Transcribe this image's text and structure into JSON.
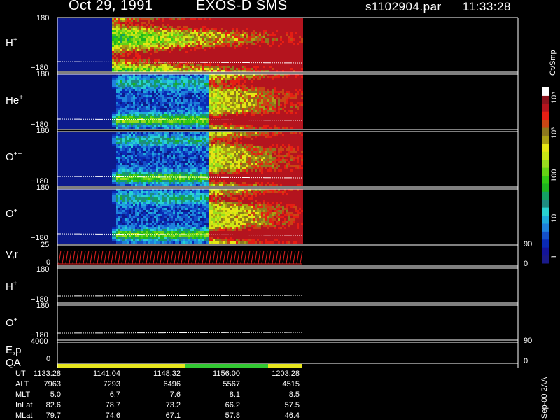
{
  "header": {
    "date": "Oct 29, 1991",
    "instrument": "EXOS-D SMS",
    "file": "s1102904.par",
    "time": "11:33:28"
  },
  "chart_data": {
    "type": "heatmap",
    "panels": [
      {
        "label": "H",
        "sup": "+",
        "ymax": "180",
        "ymin": "−180"
      },
      {
        "label": "He",
        "sup": "+",
        "ymax": "180",
        "ymin": "−180"
      },
      {
        "label": "O",
        "sup": "++",
        "ymax": "180",
        "ymin": "−180"
      },
      {
        "label": "O",
        "sup": "+",
        "ymax": "180",
        "ymin": "−180"
      },
      {
        "label": "V,r",
        "sup": "",
        "ymax": "25",
        "ymin": "0"
      },
      {
        "label": "H",
        "sup": "+",
        "ymax": "180",
        "ymin": "−180"
      },
      {
        "label": "O",
        "sup": "+",
        "ymax": "180",
        "ymin": "−180"
      },
      {
        "label": "E,p",
        "sup": "",
        "ymax": "4000",
        "ymin": ""
      },
      {
        "label": "QA",
        "sup": "",
        "ymax": "",
        "ymin": "0"
      }
    ],
    "right_axis": [
      {
        "top": "90",
        "bottom": "0"
      },
      {
        "top": "90",
        "bottom": "0"
      }
    ],
    "colorbar": {
      "unit": "Ct/Smp",
      "ticks": [
        "1",
        "10",
        "100",
        "10³",
        "10⁴"
      ],
      "colors": [
        "#1a1a8a",
        "#14149a",
        "#0a2ab4",
        "#1450c8",
        "#1e82dc",
        "#1eaadc",
        "#28d2d2",
        "#1e8c82",
        "#14a064",
        "#1eb41e",
        "#32c814",
        "#64d214",
        "#96dc1e",
        "#c8e614",
        "#e6e614",
        "#aaa014",
        "#8c781e",
        "#c84614",
        "#e61e14",
        "#b4141e",
        "#8c141e",
        "#ffffff"
      ]
    },
    "qa_bar": [
      {
        "from": 0,
        "to": 0.52,
        "color": "#e6e61e"
      },
      {
        "from": 0.52,
        "to": 0.86,
        "color": "#32c832"
      },
      {
        "from": 0.86,
        "to": 1.0,
        "color": "#e6e61e"
      }
    ]
  },
  "footer": {
    "rows": [
      {
        "name": "UT",
        "values": [
          "1133:28",
          "1141:04",
          "1148:32",
          "1156:00",
          "1203:28"
        ]
      },
      {
        "name": "ALT",
        "values": [
          "7963",
          "7293",
          "6496",
          "5567",
          "4515"
        ]
      },
      {
        "name": "MLT",
        "values": [
          "5.0",
          "6.7",
          "7.6",
          "8.1",
          "8.5"
        ]
      },
      {
        "name": "InLat",
        "values": [
          "82.6",
          "78.7",
          "73.2",
          "66.2",
          "57.5"
        ]
      },
      {
        "name": "MLat",
        "values": [
          "79.7",
          "74.6",
          "67.1",
          "57.8",
          "46.4"
        ]
      }
    ],
    "stamp": "Sep-00  2AA"
  }
}
